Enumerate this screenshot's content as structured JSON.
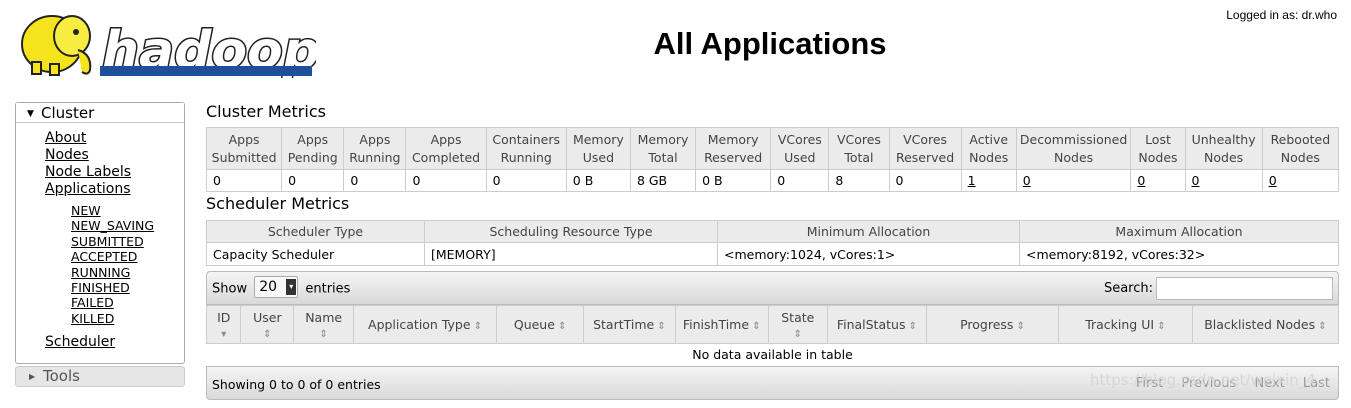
{
  "header": {
    "logo_text": "hadoop",
    "title": "All Applications",
    "logged_in": "Logged in as: dr.who"
  },
  "sidebar": {
    "section": "Cluster",
    "items": [
      "About",
      "Nodes",
      "Node Labels",
      "Applications"
    ],
    "states": [
      "NEW",
      "NEW_SAVING",
      "SUBMITTED",
      "ACCEPTED",
      "RUNNING",
      "FINISHED",
      "FAILED",
      "KILLED"
    ],
    "scheduler": "Scheduler",
    "tools": "Tools"
  },
  "cluster_metrics": {
    "title": "Cluster Metrics",
    "headers": [
      [
        "Apps",
        "Submitted"
      ],
      [
        "Apps",
        "Pending"
      ],
      [
        "Apps",
        "Running"
      ],
      [
        "Apps",
        "Completed"
      ],
      [
        "Containers",
        "Running"
      ],
      [
        "Memory",
        "Used"
      ],
      [
        "Memory",
        "Total"
      ],
      [
        "Memory",
        "Reserved"
      ],
      [
        "VCores",
        "Used"
      ],
      [
        "VCores",
        "Total"
      ],
      [
        "VCores",
        "Reserved"
      ],
      [
        "Active",
        "Nodes"
      ],
      [
        "Decommissioned",
        "Nodes"
      ],
      [
        "Lost",
        "Nodes"
      ],
      [
        "Unhealthy",
        "Nodes"
      ],
      [
        "Rebooted",
        "Nodes"
      ]
    ],
    "values": [
      "0",
      "0",
      "0",
      "0",
      "0",
      "0 B",
      "8 GB",
      "0 B",
      "0",
      "8",
      "0",
      "1",
      "0",
      "0",
      "0",
      "0"
    ]
  },
  "scheduler_metrics": {
    "title": "Scheduler Metrics",
    "headers": [
      "Scheduler Type",
      "Scheduling Resource Type",
      "Minimum Allocation",
      "Maximum Allocation"
    ],
    "values": [
      "Capacity Scheduler",
      "[MEMORY]",
      "<memory:1024, vCores:1>",
      "<memory:8192, vCores:32>"
    ]
  },
  "apps_table": {
    "show_label": "Show",
    "entries_value": "20",
    "entries_label": "entries",
    "search_label": "Search:",
    "columns": [
      "ID",
      "User",
      "Name",
      "Application Type",
      "Queue",
      "StartTime",
      "FinishTime",
      "State",
      "FinalStatus",
      "Progress",
      "Tracking UI",
      "Blacklisted Nodes"
    ],
    "empty_message": "No data available in table",
    "info": "Showing 0 to 0 of 0 entries",
    "paging": [
      "First",
      "Previous",
      "Next",
      "Last"
    ]
  },
  "watermark": "https://blog.csdn.net/weixin_4..."
}
